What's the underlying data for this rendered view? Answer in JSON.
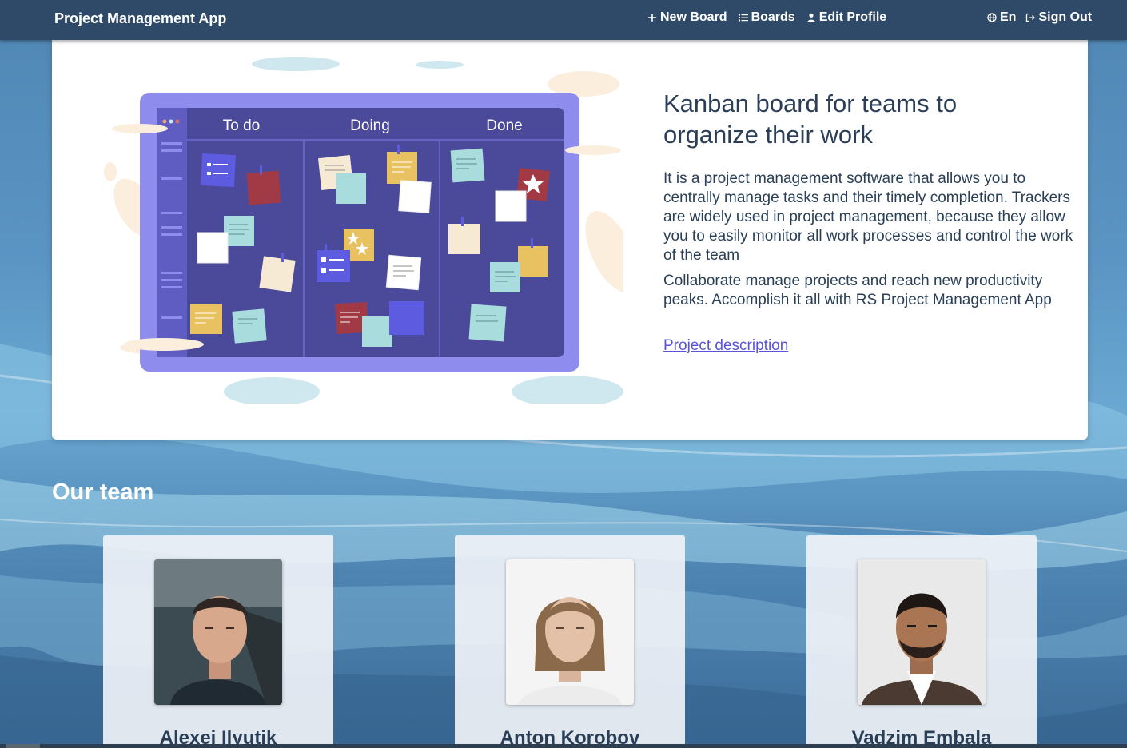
{
  "nav": {
    "brand": "Project Management App",
    "new_board": "New Board",
    "boards": "Boards",
    "edit_profile": "Edit Profile",
    "language": "En",
    "sign_out": "Sign Out"
  },
  "hero": {
    "title": "Kanban board for teams to organize their work",
    "paragraph1": "It is a project management software that allows you to centrally manage tasks and their timely completion. Trackers are widely used in project management, because they allow you to easily monitor all work processes and control the work of the team",
    "paragraph2": "Collaborate manage projects and reach new productivity peaks. Accomplish it all with RS Project Management App",
    "link": "Project description",
    "board_columns": [
      "To do",
      "Doing",
      "Done"
    ]
  },
  "team": {
    "title": "Our team",
    "members": [
      {
        "name": "Alexei Ilyutik"
      },
      {
        "name": "Anton Korobov"
      },
      {
        "name": "Vadzim Embala"
      }
    ]
  },
  "colors": {
    "navbar": "#2f4a68",
    "accent_link": "#5a55d6",
    "heading_text": "#2a3f57",
    "board_frame": "#8e8ded",
    "board_inner": "#4b4a9a"
  },
  "icons": {
    "new_board": "plus-icon",
    "boards": "list-icon",
    "edit_profile": "user-icon",
    "language": "globe-icon",
    "sign_out": "sign-out-icon"
  }
}
